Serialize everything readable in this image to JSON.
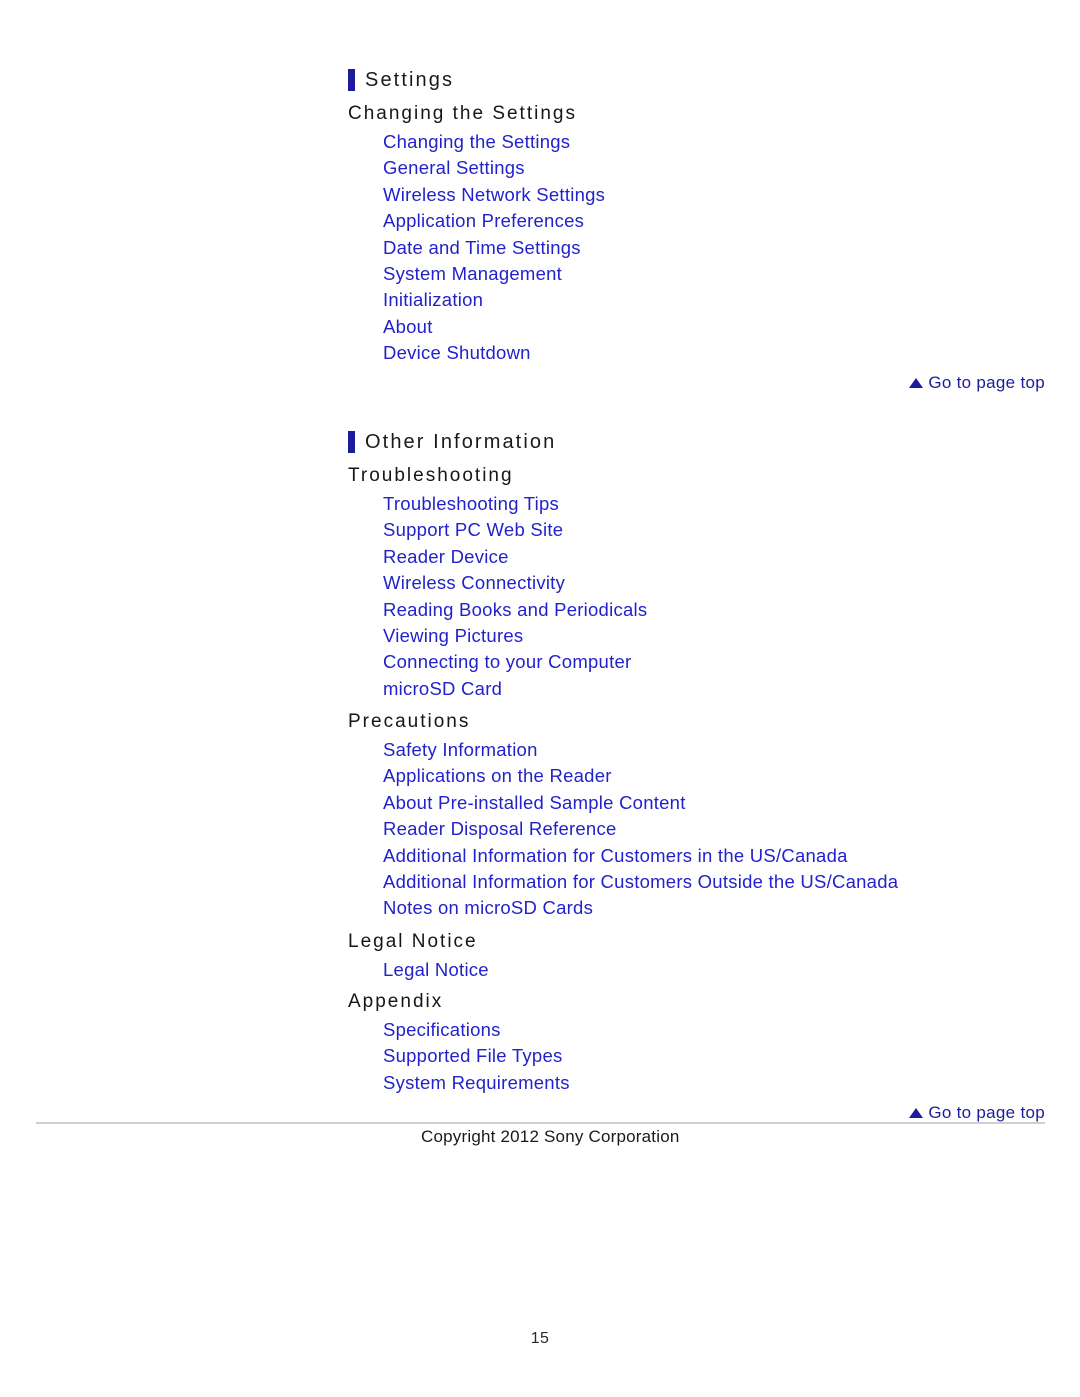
{
  "document": {
    "page_number": "15",
    "copyright": "Copyright 2012 Sony Corporation",
    "go_to_top_label": "Go to page top"
  },
  "sections": [
    {
      "title": "Settings",
      "groups": [
        {
          "heading": "Changing the Settings",
          "links": [
            "Changing the Settings",
            "General Settings",
            "Wireless Network Settings",
            "Application Preferences",
            "Date and Time Settings",
            "System Management",
            "Initialization",
            "About",
            "Device Shutdown"
          ]
        }
      ]
    },
    {
      "title": "Other Information",
      "groups": [
        {
          "heading": "Troubleshooting",
          "links": [
            "Troubleshooting Tips",
            "Support PC Web Site",
            "Reader Device",
            "Wireless Connectivity",
            "Reading Books and Periodicals",
            "Viewing Pictures",
            "Connecting to your Computer",
            "microSD Card"
          ]
        },
        {
          "heading": "Precautions",
          "links": [
            "Safety Information",
            "Applications on the Reader",
            "About Pre-installed Sample Content",
            "Reader Disposal Reference",
            "Additional Information for Customers in the US/Canada",
            "Additional Information for Customers Outside the US/Canada",
            "Notes on microSD Cards"
          ]
        },
        {
          "heading": "Legal Notice",
          "links": [
            "Legal Notice"
          ]
        },
        {
          "heading": "Appendix",
          "links": [
            "Specifications",
            "Supported File Types",
            "System Requirements"
          ]
        }
      ]
    }
  ],
  "colors": {
    "link": "#2222cc",
    "accent_bar": "#1c1c9c",
    "rule": "#cfcfcf",
    "text": "#1a1a1a"
  }
}
